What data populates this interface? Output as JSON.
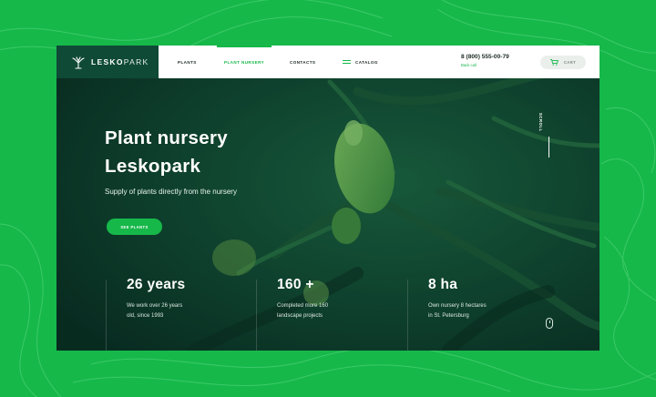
{
  "brand": {
    "name_bold": "LESKO",
    "name_thin": "PARK"
  },
  "nav": {
    "items": [
      {
        "label": "PLANTS"
      },
      {
        "label": "PLANT NURSERY"
      },
      {
        "label": "CONTACTS"
      },
      {
        "label": "CATALOG"
      }
    ],
    "active_index": 1
  },
  "contact": {
    "phone": "8 (800) 555-00-79",
    "callback": "Back call"
  },
  "cart": {
    "label": "CART",
    "icon": "cart-icon"
  },
  "hero": {
    "title_line1": "Plant nursery",
    "title_line2": "Leskopark",
    "subtitle": "Supply of plants directly from the nursery",
    "cta": "SEE PLANTS"
  },
  "scroll": {
    "label": "SCROLL",
    "icon": "mouse-icon"
  },
  "stats": [
    {
      "value": "26 years",
      "line1": "We work over 26 years",
      "line2": "old, since 1993"
    },
    {
      "value": "160 +",
      "line1": "Completed more 160",
      "line2": "landscape projects"
    },
    {
      "value": "8 ha",
      "line1": "Own nursery 8 hectares",
      "line2": "in St. Petersburg"
    }
  ],
  "colors": {
    "accent": "#16b84a",
    "dark": "#0f4a37",
    "header_bg": "#ffffff"
  }
}
